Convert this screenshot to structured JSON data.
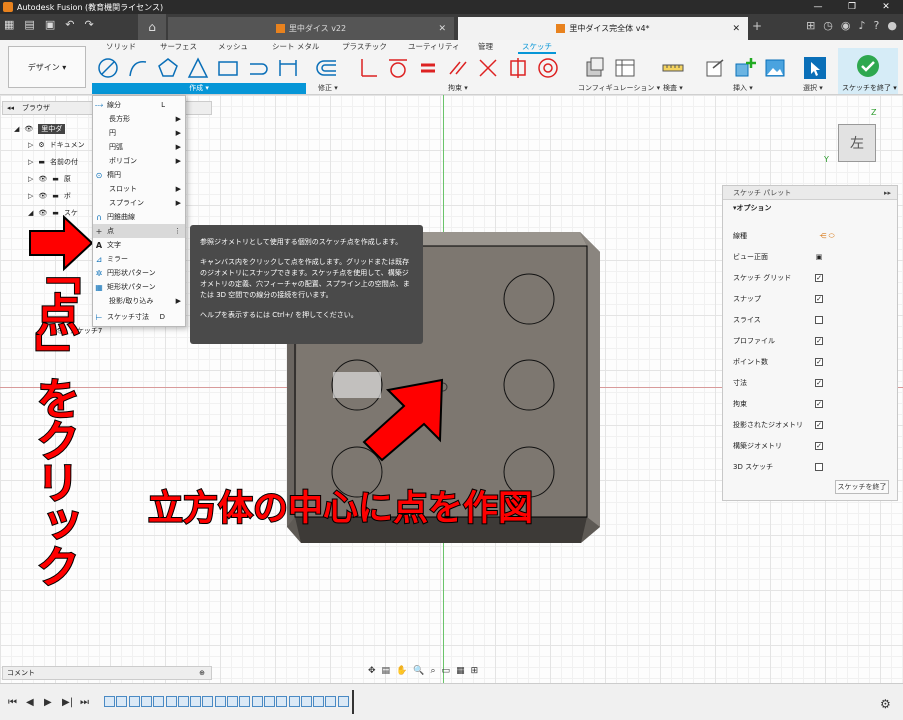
{
  "window": {
    "title": "Autodesk Fusion (教育機関ライセンス)"
  },
  "doc_tabs": [
    {
      "label": "里中ダイス v22"
    },
    {
      "label": "里中ダイス完全体 v4*"
    }
  ],
  "ribbon": {
    "design_button": "デザイン ▾",
    "tabs": [
      "ソリッド",
      "サーフェス",
      "メッシュ",
      "シート メタル",
      "プラスチック",
      "ユーティリティ",
      "管理",
      "スケッチ"
    ],
    "groups": {
      "create": "作成 ▾",
      "modify": "修正 ▾",
      "constraints": "拘束 ▾",
      "configure": "コンフィギュレーション ▾",
      "inspect": "検査 ▾",
      "insert": "挿入 ▾",
      "select": "選択 ▾",
      "finish": "スケッチを終了 ▾"
    }
  },
  "browser": {
    "title": "ブラウザ",
    "rows": [
      "里中ダ",
      "ドキュメン",
      "名前の付",
      "原",
      "ボ",
      "スケ"
    ],
    "sketch7": "スケッチ7"
  },
  "create_menu": {
    "items": [
      {
        "label": "線分",
        "key": "L",
        "icon": "line-icon"
      },
      {
        "label": "長方形",
        "submenu": true
      },
      {
        "label": "円",
        "submenu": true
      },
      {
        "label": "円弧",
        "submenu": true
      },
      {
        "label": "ポリゴン",
        "submenu": true
      },
      {
        "label": "楕円",
        "icon": "ellipse-icon"
      },
      {
        "label": "スロット",
        "submenu": true
      },
      {
        "label": "スプライン",
        "submenu": true
      },
      {
        "label": "円錐曲線",
        "icon": "conic-icon"
      },
      {
        "label": "点",
        "icon": "point-icon",
        "highlight": true
      },
      {
        "label": "文字",
        "icon": "text-icon"
      },
      {
        "label": "ミラー",
        "icon": "mirror-icon"
      },
      {
        "label": "円形状パターン",
        "icon": "circular-pattern-icon"
      },
      {
        "label": "矩形状パターン",
        "icon": "rect-pattern-icon"
      },
      {
        "label": "投影/取り込み",
        "submenu": true
      },
      {
        "label": "スケッチ寸法",
        "key": "D",
        "icon": "dimension-icon"
      }
    ]
  },
  "tooltip": {
    "p1": "参照ジオメトリとして使用する個別のスケッチ点を作成します。",
    "p2": "キャンバス内をクリックして点を作成します。グリッドまたは既存のジオメトリにスナップできます。スケッチ点を使用して、構築ジオメトリの定義、穴フィーチャの配置、スプライン上の空間点、または 3D 空間での線分の接続を行います。",
    "p3": "ヘルプを表示するには Ctrl+/ を押してください。"
  },
  "annotations": {
    "vertical": "「点」をクリック",
    "bottom": "立方体の中心に点を作図"
  },
  "viewcube": {
    "face": "左",
    "z": "Z",
    "y": "Y"
  },
  "palette": {
    "title": "スケッチ パレット",
    "section": "オプション",
    "rows": [
      {
        "label": "線種",
        "type": "icon"
      },
      {
        "label": "ビュー正面",
        "type": "icon"
      },
      {
        "label": "スケッチ グリッド",
        "checked": true
      },
      {
        "label": "スナップ",
        "checked": true
      },
      {
        "label": "スライス",
        "checked": false
      },
      {
        "label": "プロファイル",
        "checked": true
      },
      {
        "label": "ポイント数",
        "checked": true
      },
      {
        "label": "寸法",
        "checked": true
      },
      {
        "label": "拘束",
        "checked": true
      },
      {
        "label": "投影されたジオメトリ",
        "checked": true
      },
      {
        "label": "構築ジオメトリ",
        "checked": true
      },
      {
        "label": "3D スケッチ",
        "checked": false
      }
    ],
    "finish": "スケッチを終了"
  },
  "comment_bar": {
    "label": "コメント"
  },
  "colors": {
    "accent": "#0696d7",
    "annotation": "#ff0000",
    "cube": "#7d7770"
  }
}
